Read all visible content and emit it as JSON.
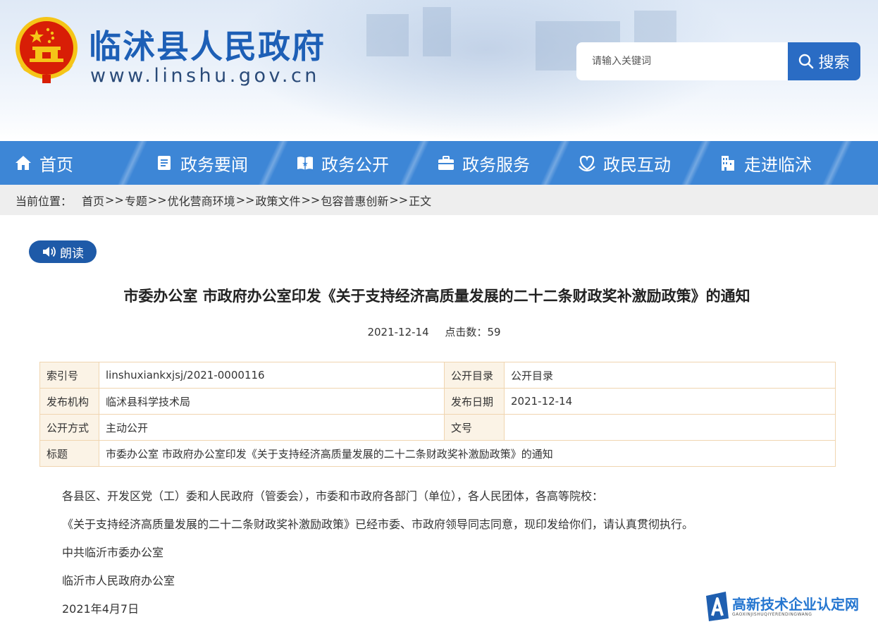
{
  "header": {
    "site_name": "临沭县人民政府",
    "site_url": "www.linshu.gov.cn",
    "search_placeholder": "请输入关键词",
    "search_button": "搜索"
  },
  "nav": {
    "items": [
      {
        "label": "首页",
        "icon": "home-icon"
      },
      {
        "label": "政务要闻",
        "icon": "news-icon"
      },
      {
        "label": "政务公开",
        "icon": "open-book-icon"
      },
      {
        "label": "政务服务",
        "icon": "briefcase-icon"
      },
      {
        "label": "政民互动",
        "icon": "interaction-icon"
      },
      {
        "label": "走进临沭",
        "icon": "building-icon"
      }
    ]
  },
  "breadcrumb": {
    "label": "当前位置：",
    "separator": ">>",
    "items": [
      "首页",
      "专题",
      "优化营商环境",
      "政策文件",
      "包容普惠创新",
      "正文"
    ]
  },
  "read_button": "朗读",
  "article": {
    "title": "市委办公室 市政府办公室印发《关于支持经济高质量发展的二十二条财政奖补激励政策》的通知",
    "date": "2021-12-14",
    "hits_label": "点击数：",
    "hits": "59"
  },
  "info_table": {
    "index_label": "索引号",
    "index_value": "linshuxiankxjsj/2021-0000116",
    "catalog_label": "公开目录",
    "catalog_value": "公开目录",
    "org_label": "发布机构",
    "org_value": "临沭县科学技术局",
    "pubdate_label": "发布日期",
    "pubdate_value": "2021-12-14",
    "mode_label": "公开方式",
    "mode_value": "主动公开",
    "docno_label": "文号",
    "docno_value": "",
    "subject_label": "标题",
    "subject_value": "市委办公室 市政府办公室印发《关于支持经济高质量发展的二十二条财政奖补激励政策》的通知"
  },
  "body": {
    "paragraphs": [
      "各县区、开发区党（工）委和人民政府（管委会），市委和市政府各部门（单位），各人民团体，各高等院校：",
      "《关于支持经济高质量发展的二十二条财政奖补激励政策》已经市委、市政府领导同志同意，现印发给你们，请认真贯彻执行。",
      "中共临沂市委办公室",
      "临沂市人民政府办公室",
      "2021年4月7日"
    ]
  },
  "watermark": {
    "title": "高新技术企业认定网",
    "subtitle": "GAOXINJISHUQIYERENDINGWANG"
  },
  "colors": {
    "nav_blue": "#3d86d6",
    "brand_blue": "#1d5fb6",
    "search_blue": "#2a6cc4",
    "read_blue": "#1e5aa8",
    "table_border": "#f0d5b0",
    "emblem_red": "#d81e06",
    "emblem_gold": "#f5c518"
  }
}
